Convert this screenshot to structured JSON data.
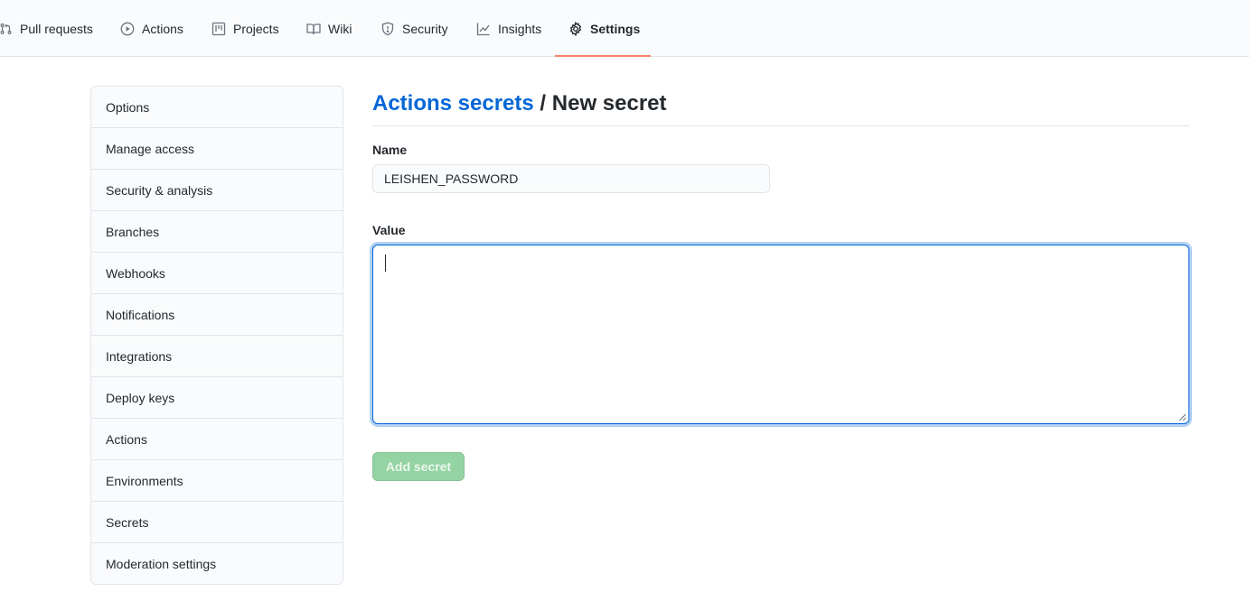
{
  "repo_nav": {
    "tabs": [
      {
        "label": "Pull requests",
        "icon": "git-pull-request-icon"
      },
      {
        "label": "Actions",
        "icon": "play-icon"
      },
      {
        "label": "Projects",
        "icon": "project-icon"
      },
      {
        "label": "Wiki",
        "icon": "book-icon"
      },
      {
        "label": "Security",
        "icon": "shield-icon"
      },
      {
        "label": "Insights",
        "icon": "graph-icon"
      },
      {
        "label": "Settings",
        "icon": "gear-icon",
        "selected": true
      }
    ],
    "selected_underline_color": "#f9826c"
  },
  "sidebar": {
    "items": [
      {
        "label": "Options"
      },
      {
        "label": "Manage access"
      },
      {
        "label": "Security & analysis"
      },
      {
        "label": "Branches"
      },
      {
        "label": "Webhooks"
      },
      {
        "label": "Notifications"
      },
      {
        "label": "Integrations"
      },
      {
        "label": "Deploy keys"
      },
      {
        "label": "Actions"
      },
      {
        "label": "Environments"
      },
      {
        "label": "Secrets"
      },
      {
        "label": "Moderation settings"
      }
    ]
  },
  "main": {
    "breadcrumb_link": "Actions secrets",
    "breadcrumb_separator": " / ",
    "page_title": "New secret",
    "name_label": "Name",
    "name_value": "LEISHEN_PASSWORD",
    "value_label": "Value",
    "value_text": "",
    "submit_label": "Add secret"
  },
  "colors": {
    "link": "#0366d6",
    "focus_border": "#0366d6",
    "button_disabled_green": "#94d3a2"
  }
}
